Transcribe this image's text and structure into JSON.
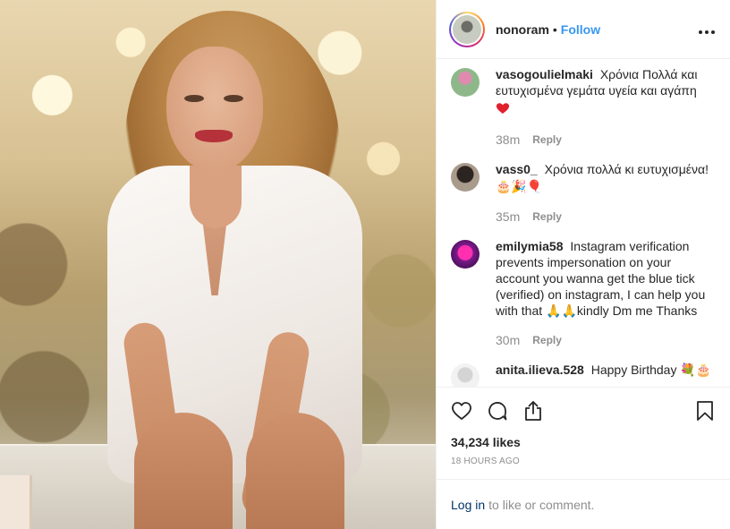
{
  "header": {
    "username": "nonoram",
    "separator": "•",
    "follow_label": "Follow",
    "more_label": "•••"
  },
  "comments": [
    {
      "author": "vasogoulielmaki",
      "text": "Χρόνια Πολλά και ευτυχισμένα γεμάτα υγεία και αγάπη",
      "emojis": "❤",
      "time": "38m",
      "reply_label": "Reply"
    },
    {
      "author": "vass0_",
      "text": "Χρόνια πολλά κι ευτυχισμένα!",
      "emojis": "🎂🎉🎈",
      "time": "35m",
      "reply_label": "Reply"
    },
    {
      "author": "emilymia58",
      "text": "Instagram verification prevents impersonation on your account you wanna get the blue tick (verified) on instagram, I can help you with that 🙏🙏kindly Dm me Thanks",
      "emojis": "",
      "time": "30m",
      "reply_label": "Reply"
    },
    {
      "author": "anita.ilieva.528",
      "text": "Happy Birthday",
      "emojis": "💐🎂",
      "time": "",
      "reply_label": ""
    }
  ],
  "actions": {
    "icons": [
      "heart-icon",
      "comment-icon",
      "share-icon",
      "bookmark-icon"
    ]
  },
  "likes": "34,234 likes",
  "timestamp": "18 HOURS AGO",
  "login_bar": {
    "login_label": "Log in",
    "suffix": "to like or comment."
  },
  "colors": {
    "link_blue": "#3897f0",
    "text": "#262626",
    "muted": "#8e8e8e",
    "heart_red": "#ed4956"
  }
}
